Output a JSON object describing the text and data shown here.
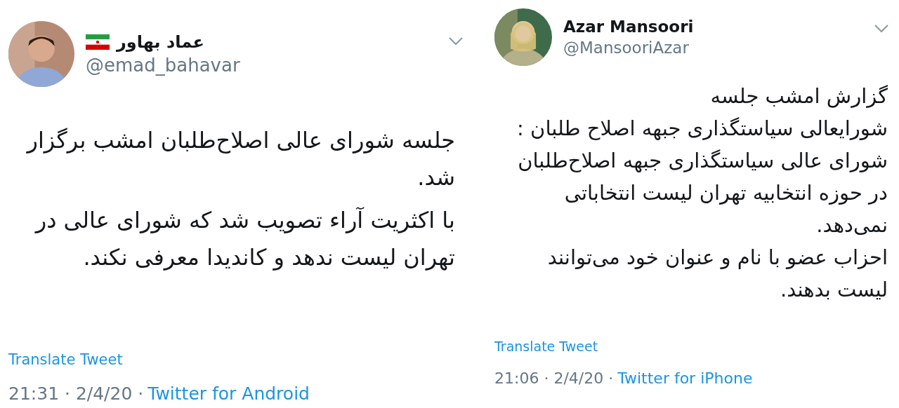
{
  "tweets": [
    {
      "name": "عماد بهاور",
      "verified_flag": true,
      "handle": "@emad_bahavar",
      "paragraphs": [
        "جلسه شورای عالی اصلاح‌طلبان امشب برگزار شد.",
        "با اکثریت آراء تصویب شد که شورای عالی در تهران لیست ندهد و کاندیدا معرفی نکند."
      ],
      "translate": "Translate Tweet",
      "timestamp": "21:31 · 2/4/20 ·",
      "source": "Twitter for Android"
    },
    {
      "name": "Azar Mansoori",
      "verified_flag": false,
      "handle": "@MansooriAzar",
      "paragraphs": [
        "گزارش امشب جلسه",
        "شورایعالی سیاستگذاری جبهه اصلاح طلبان :",
        "شورای عالی سیاستگذاری جبهه اصلاح‌طلبان",
        "در حوزه انتخابیه تهران لیست انتخاباتی",
        "نمی‌دهد.",
        "احزاب عضو با نام و عنوان خود می‌توانند",
        "لیست بدهند."
      ],
      "translate": "Translate Tweet",
      "timestamp": "21:06 · 2/4/20 ·",
      "source": "Twitter for iPhone"
    }
  ]
}
